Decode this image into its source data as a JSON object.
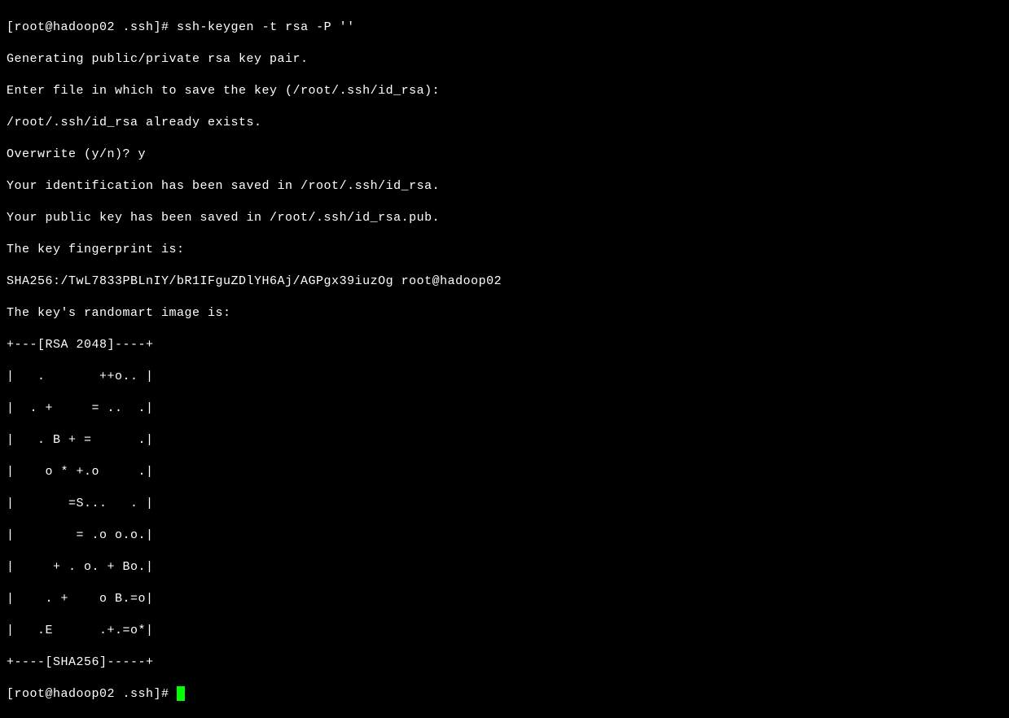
{
  "terminal": {
    "prompt1": "[root@hadoop02 .ssh]# ",
    "command": "ssh-keygen -t rsa -P ''",
    "line1": "Generating public/private rsa key pair.",
    "line2": "Enter file in which to save the key (/root/.ssh/id_rsa): ",
    "line3": "/root/.ssh/id_rsa already exists.",
    "line4": "Overwrite (y/n)? y",
    "line5": "Your identification has been saved in /root/.ssh/id_rsa.",
    "line6": "Your public key has been saved in /root/.ssh/id_rsa.pub.",
    "line7": "The key fingerprint is:",
    "line8": "SHA256:/TwL7833PBLnIY/bR1IFguZDlYH6Aj/AGPgx39iuzOg root@hadoop02",
    "line9": "The key's randomart image is:",
    "art01": "+---[RSA 2048]----+",
    "art02": "|   .       ++o.. |",
    "art03": "|  . +     = ..  .|",
    "art04": "|   . B + =      .|",
    "art05": "|    o * +.o     .|",
    "art06": "|       =S...   . |",
    "art07": "|        = .o o.o.|",
    "art08": "|     + . o. + Bo.|",
    "art09": "|    . +    o B.=o|",
    "art10": "|   .E      .+.=o*|",
    "art11": "+----[SHA256]-----+",
    "prompt2": "[root@hadoop02 .ssh]# "
  }
}
